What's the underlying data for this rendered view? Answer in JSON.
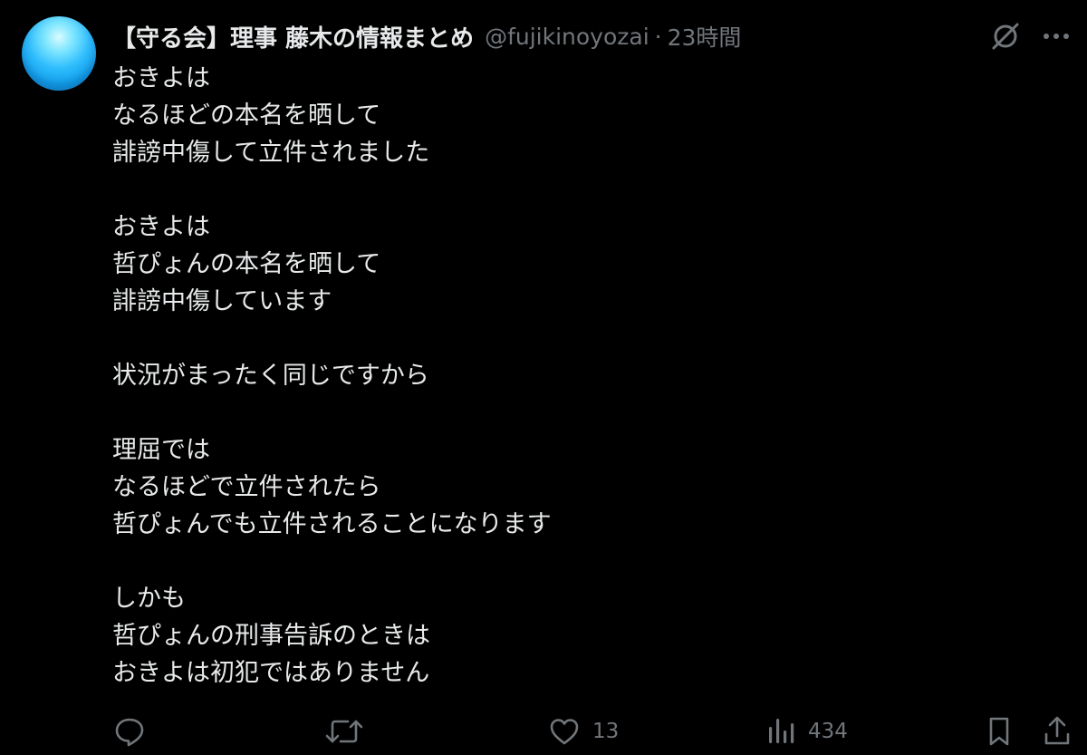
{
  "header": {
    "display_name": "【守る会】理事 藤木の情報まとめ",
    "handle": "@fujikinoyozai",
    "separator": "·",
    "time": "23時間"
  },
  "tweet": {
    "lines": [
      "おきよは",
      "なるほどの本名を晒して",
      "誹謗中傷して立件されました",
      "",
      "おきよは",
      "哲ぴょんの本名を晒して",
      "誹謗中傷しています",
      "",
      "状況がまったく同じですから",
      "",
      "理屈では",
      "なるほどで立件されたら",
      "哲ぴょんでも立件されることになります",
      "",
      "しかも",
      "哲ぴょんの刑事告訴のときは",
      "おきよは初犯ではありません"
    ]
  },
  "actions": {
    "reply_icon": "reply-icon",
    "retweet_icon": "retweet-icon",
    "like_icon": "heart-icon",
    "like_count": "13",
    "views_icon": "views-bar-icon",
    "views_count": "434",
    "bookmark_icon": "bookmark-icon",
    "share_icon": "share-icon"
  },
  "colors": {
    "background": "#000000",
    "text": "#e7e9ea",
    "secondary": "#71767b",
    "avatar": "#1fa8f0"
  }
}
